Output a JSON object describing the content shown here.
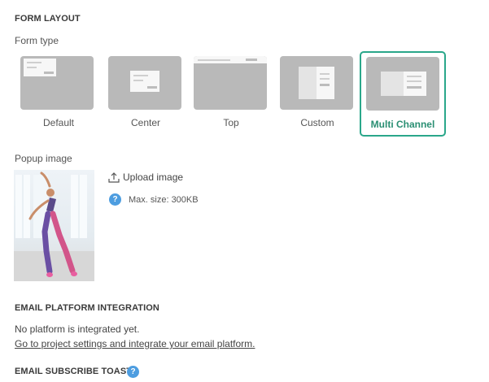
{
  "form_layout": {
    "section_title": "FORM LAYOUT",
    "form_type_label": "Form type",
    "types": [
      {
        "label": "Default",
        "selected": false
      },
      {
        "label": "Center",
        "selected": false
      },
      {
        "label": "Top",
        "selected": false
      },
      {
        "label": "Custom",
        "selected": false
      },
      {
        "label": "Multi Channel",
        "selected": true
      }
    ],
    "accent_color": "#2aa78a"
  },
  "popup_image": {
    "label": "Popup image",
    "upload_label": "Upload image",
    "max_size_text": "Max. size: 300KB",
    "help_icon": "?"
  },
  "email_integration": {
    "section_title": "EMAIL PLATFORM INTEGRATION",
    "status_text": "No platform is integrated yet.",
    "link_text": "Go to project settings and integrate your email platform."
  },
  "email_toast": {
    "section_title": "EMAIL SUBSCRIBE TOAST",
    "help_icon": "?"
  }
}
